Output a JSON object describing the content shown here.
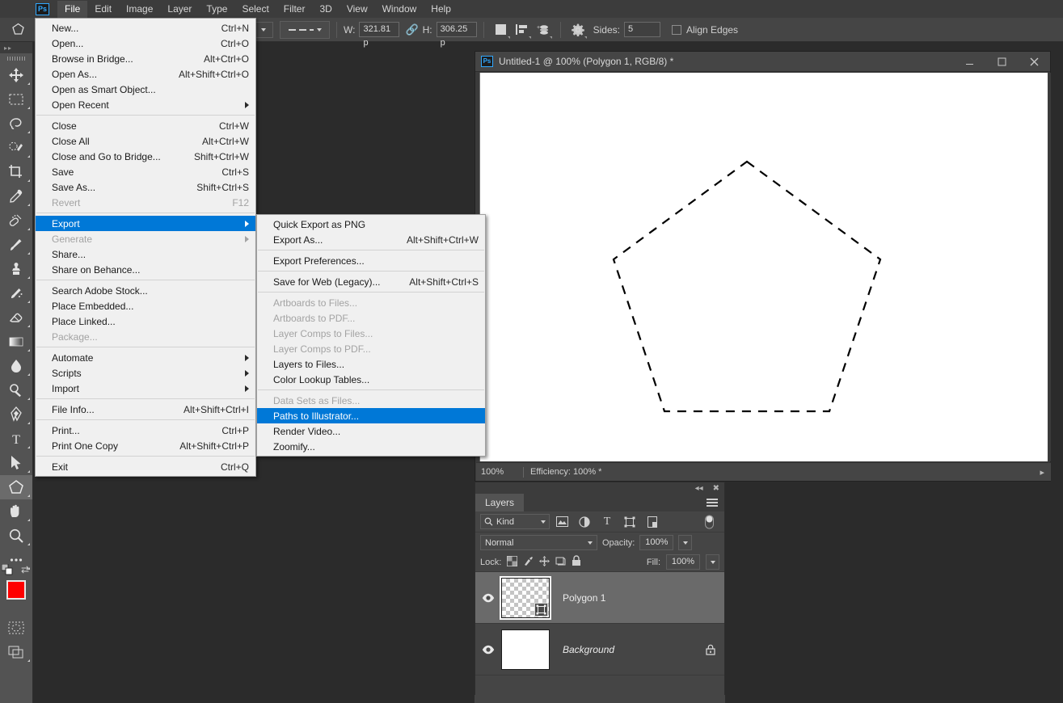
{
  "app": {
    "logo": "Ps"
  },
  "menubar": {
    "items": [
      {
        "label": "File",
        "active": true
      },
      {
        "label": "Edit",
        "active": false
      },
      {
        "label": "Image",
        "active": false
      },
      {
        "label": "Layer",
        "active": false
      },
      {
        "label": "Type",
        "active": false
      },
      {
        "label": "Select",
        "active": false
      },
      {
        "label": "Filter",
        "active": false
      },
      {
        "label": "3D",
        "active": false
      },
      {
        "label": "View",
        "active": false
      },
      {
        "label": "Window",
        "active": false
      },
      {
        "label": "Help",
        "active": false
      }
    ]
  },
  "options_bar": {
    "tool_preset_icon": "polygon-shape-icon",
    "shape_combo_icon": "chevron-down-icon",
    "stroke_style_icon": "dashed-line-icon",
    "width_label": "W:",
    "width_value": "321.81 p",
    "link_icon": "link-chain-icon",
    "height_label": "H:",
    "height_value": "306.25 p",
    "path_operations_icon": "path-operations-icon",
    "path_alignment_icon": "path-alignment-icon",
    "path_arrangement_icon": "path-arrangement-icon",
    "geometry_options_icon": "gear-icon",
    "sides_label": "Sides:",
    "sides_value": "5",
    "align_edges_label": "Align Edges",
    "align_edges_checked": false
  },
  "toolbar": {
    "tools": [
      {
        "name": "move-tool",
        "icon": "move",
        "selected": false
      },
      {
        "name": "rectangular-marquee-tool",
        "icon": "marquee",
        "selected": false
      },
      {
        "name": "lasso-tool",
        "icon": "lasso",
        "selected": false
      },
      {
        "name": "quick-selection-tool",
        "icon": "quickselect",
        "selected": false
      },
      {
        "name": "crop-tool",
        "icon": "crop",
        "selected": false
      },
      {
        "name": "eyedropper-tool",
        "icon": "eyedropper",
        "selected": false
      },
      {
        "name": "spot-healing-brush-tool",
        "icon": "healing",
        "selected": false
      },
      {
        "name": "brush-tool",
        "icon": "brush",
        "selected": false
      },
      {
        "name": "clone-stamp-tool",
        "icon": "stamp",
        "selected": false
      },
      {
        "name": "history-brush-tool",
        "icon": "historybrush",
        "selected": false
      },
      {
        "name": "eraser-tool",
        "icon": "eraser",
        "selected": false
      },
      {
        "name": "gradient-tool",
        "icon": "gradient",
        "selected": false
      },
      {
        "name": "blur-tool",
        "icon": "blur",
        "selected": false
      },
      {
        "name": "dodge-tool",
        "icon": "dodge",
        "selected": false
      },
      {
        "name": "pen-tool",
        "icon": "pen",
        "selected": false
      },
      {
        "name": "type-tool",
        "icon": "type",
        "selected": false
      },
      {
        "name": "path-selection-tool",
        "icon": "pathselect",
        "selected": false
      },
      {
        "name": "polygon-tool",
        "icon": "polygon",
        "selected": true
      },
      {
        "name": "hand-tool",
        "icon": "hand",
        "selected": false
      },
      {
        "name": "zoom-tool",
        "icon": "zoom",
        "selected": false
      },
      {
        "name": "edit-toolbar-tool",
        "icon": "ellipsis",
        "selected": false
      }
    ],
    "foreground_color": "#ff0000",
    "background_color": "#ffffff",
    "quick_mask_icon": "quick-mask-icon",
    "screen_mode_icon": "screen-mode-icon"
  },
  "file_menu": {
    "groups": [
      [
        {
          "label": "New...",
          "accel": "Ctrl+N",
          "disabled": false,
          "submenu": false,
          "highlight": false
        },
        {
          "label": "Open...",
          "accel": "Ctrl+O",
          "disabled": false,
          "submenu": false,
          "highlight": false
        },
        {
          "label": "Browse in Bridge...",
          "accel": "Alt+Ctrl+O",
          "disabled": false,
          "submenu": false,
          "highlight": false
        },
        {
          "label": "Open As...",
          "accel": "Alt+Shift+Ctrl+O",
          "disabled": false,
          "submenu": false,
          "highlight": false
        },
        {
          "label": "Open as Smart Object...",
          "accel": "",
          "disabled": false,
          "submenu": false,
          "highlight": false
        },
        {
          "label": "Open Recent",
          "accel": "",
          "disabled": false,
          "submenu": true,
          "highlight": false
        }
      ],
      [
        {
          "label": "Close",
          "accel": "Ctrl+W",
          "disabled": false,
          "submenu": false,
          "highlight": false
        },
        {
          "label": "Close All",
          "accel": "Alt+Ctrl+W",
          "disabled": false,
          "submenu": false,
          "highlight": false
        },
        {
          "label": "Close and Go to Bridge...",
          "accel": "Shift+Ctrl+W",
          "disabled": false,
          "submenu": false,
          "highlight": false
        },
        {
          "label": "Save",
          "accel": "Ctrl+S",
          "disabled": false,
          "submenu": false,
          "highlight": false
        },
        {
          "label": "Save As...",
          "accel": "Shift+Ctrl+S",
          "disabled": false,
          "submenu": false,
          "highlight": false
        },
        {
          "label": "Revert",
          "accel": "F12",
          "disabled": true,
          "submenu": false,
          "highlight": false
        }
      ],
      [
        {
          "label": "Export",
          "accel": "",
          "disabled": false,
          "submenu": true,
          "highlight": true
        },
        {
          "label": "Generate",
          "accel": "",
          "disabled": true,
          "submenu": true,
          "highlight": false
        },
        {
          "label": "Share...",
          "accel": "",
          "disabled": false,
          "submenu": false,
          "highlight": false
        },
        {
          "label": "Share on Behance...",
          "accel": "",
          "disabled": false,
          "submenu": false,
          "highlight": false
        }
      ],
      [
        {
          "label": "Search Adobe Stock...",
          "accel": "",
          "disabled": false,
          "submenu": false,
          "highlight": false
        },
        {
          "label": "Place Embedded...",
          "accel": "",
          "disabled": false,
          "submenu": false,
          "highlight": false
        },
        {
          "label": "Place Linked...",
          "accel": "",
          "disabled": false,
          "submenu": false,
          "highlight": false
        },
        {
          "label": "Package...",
          "accel": "",
          "disabled": true,
          "submenu": false,
          "highlight": false
        }
      ],
      [
        {
          "label": "Automate",
          "accel": "",
          "disabled": false,
          "submenu": true,
          "highlight": false
        },
        {
          "label": "Scripts",
          "accel": "",
          "disabled": false,
          "submenu": true,
          "highlight": false
        },
        {
          "label": "Import",
          "accel": "",
          "disabled": false,
          "submenu": true,
          "highlight": false
        }
      ],
      [
        {
          "label": "File Info...",
          "accel": "Alt+Shift+Ctrl+I",
          "disabled": false,
          "submenu": false,
          "highlight": false
        }
      ],
      [
        {
          "label": "Print...",
          "accel": "Ctrl+P",
          "disabled": false,
          "submenu": false,
          "highlight": false
        },
        {
          "label": "Print One Copy",
          "accel": "Alt+Shift+Ctrl+P",
          "disabled": false,
          "submenu": false,
          "highlight": false
        }
      ],
      [
        {
          "label": "Exit",
          "accel": "Ctrl+Q",
          "disabled": false,
          "submenu": false,
          "highlight": false
        }
      ]
    ]
  },
  "export_menu": {
    "groups": [
      [
        {
          "label": "Quick Export as PNG",
          "accel": "",
          "disabled": false,
          "highlight": false
        },
        {
          "label": "Export As...",
          "accel": "Alt+Shift+Ctrl+W",
          "disabled": false,
          "highlight": false
        }
      ],
      [
        {
          "label": "Export Preferences...",
          "accel": "",
          "disabled": false,
          "highlight": false
        }
      ],
      [
        {
          "label": "Save for Web (Legacy)...",
          "accel": "Alt+Shift+Ctrl+S",
          "disabled": false,
          "highlight": false
        }
      ],
      [
        {
          "label": "Artboards to Files...",
          "accel": "",
          "disabled": true,
          "highlight": false
        },
        {
          "label": "Artboards to PDF...",
          "accel": "",
          "disabled": true,
          "highlight": false
        },
        {
          "label": "Layer Comps to Files...",
          "accel": "",
          "disabled": true,
          "highlight": false
        },
        {
          "label": "Layer Comps to PDF...",
          "accel": "",
          "disabled": true,
          "highlight": false
        },
        {
          "label": "Layers to Files...",
          "accel": "",
          "disabled": false,
          "highlight": false
        },
        {
          "label": "Color Lookup Tables...",
          "accel": "",
          "disabled": false,
          "highlight": false
        }
      ],
      [
        {
          "label": "Data Sets as Files...",
          "accel": "",
          "disabled": true,
          "highlight": false
        },
        {
          "label": "Paths to Illustrator...",
          "accel": "",
          "disabled": false,
          "highlight": true
        },
        {
          "label": "Render Video...",
          "accel": "",
          "disabled": false,
          "highlight": false
        },
        {
          "label": "Zoomify...",
          "accel": "",
          "disabled": false,
          "highlight": false
        }
      ]
    ]
  },
  "document": {
    "title": "Untitled-1 @ 100% (Polygon 1, RGB/8) *",
    "minimize_icon": "minimize-icon",
    "maximize_icon": "maximize-icon",
    "close_icon": "close-icon",
    "status_zoom": "100%",
    "status_info": "Efficiency: 100% *",
    "canvas_shape": "pentagon-path-selection",
    "shape_sides": 5
  },
  "layers_panel": {
    "collapse_icon": "collapse-icon",
    "close_icon": "close-icon",
    "tab_label": "Layers",
    "menu_icon": "panel-menu-icon",
    "filter_kind_label": "Kind",
    "filter_search_icon": "search-icon",
    "filter_icons": [
      "pixel-layer-filter-icon",
      "adjustment-layer-filter-icon",
      "type-layer-filter-icon",
      "shape-layer-filter-icon",
      "smart-object-filter-icon"
    ],
    "filter_toggle_icon": "filter-toggle-icon",
    "blend_mode": "Normal",
    "opacity_label": "Opacity:",
    "opacity_value": "100%",
    "lock_label": "Lock:",
    "lock_icons": [
      "lock-transparent-pixels-icon",
      "lock-image-pixels-icon",
      "lock-position-icon",
      "lock-artboard-icon",
      "lock-all-icon"
    ],
    "fill_label": "Fill:",
    "fill_value": "100%",
    "layers": [
      {
        "name": "Polygon 1",
        "visible": true,
        "selected": true,
        "italic": false,
        "locked": false,
        "thumbnail": "transparent-checker",
        "badge_icon": "vector-mask-icon",
        "eye_icon": "eye-icon"
      },
      {
        "name": "Background",
        "visible": true,
        "selected": false,
        "italic": true,
        "locked": true,
        "thumbnail": "white",
        "badge_icon": "",
        "eye_icon": "eye-icon",
        "lock_icon": "lock-icon"
      }
    ]
  }
}
